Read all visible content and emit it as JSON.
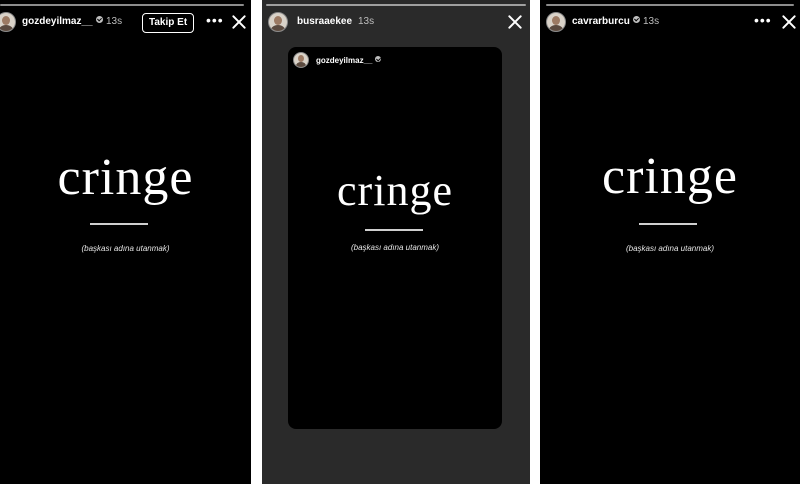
{
  "stories": [
    {
      "username": "gozdeyilmaz__",
      "verified": true,
      "time": "13s",
      "follow_label": "Takip Et",
      "more_icon": "more-horizontal-icon",
      "close_icon": "close-icon",
      "word": "cringe",
      "caption": "(başkası adına utanmak)"
    },
    {
      "username": "busraaekee",
      "verified": false,
      "time": "13s",
      "close_icon": "close-icon",
      "shared_story": {
        "username": "gozdeyilmaz__",
        "verified": true,
        "word": "cringe",
        "caption": "(başkası adına utanmak)"
      }
    },
    {
      "username": "cavrarburcu",
      "verified": true,
      "time": "13s",
      "more_icon": "more-horizontal-icon",
      "close_icon": "close-icon",
      "word": "cringe",
      "caption": "(başkası adına utanmak)"
    }
  ],
  "colors": {
    "background": "#000000",
    "shared_background": "#2a2a2a",
    "text": "#ffffff",
    "muted": "#bdbdbd"
  }
}
